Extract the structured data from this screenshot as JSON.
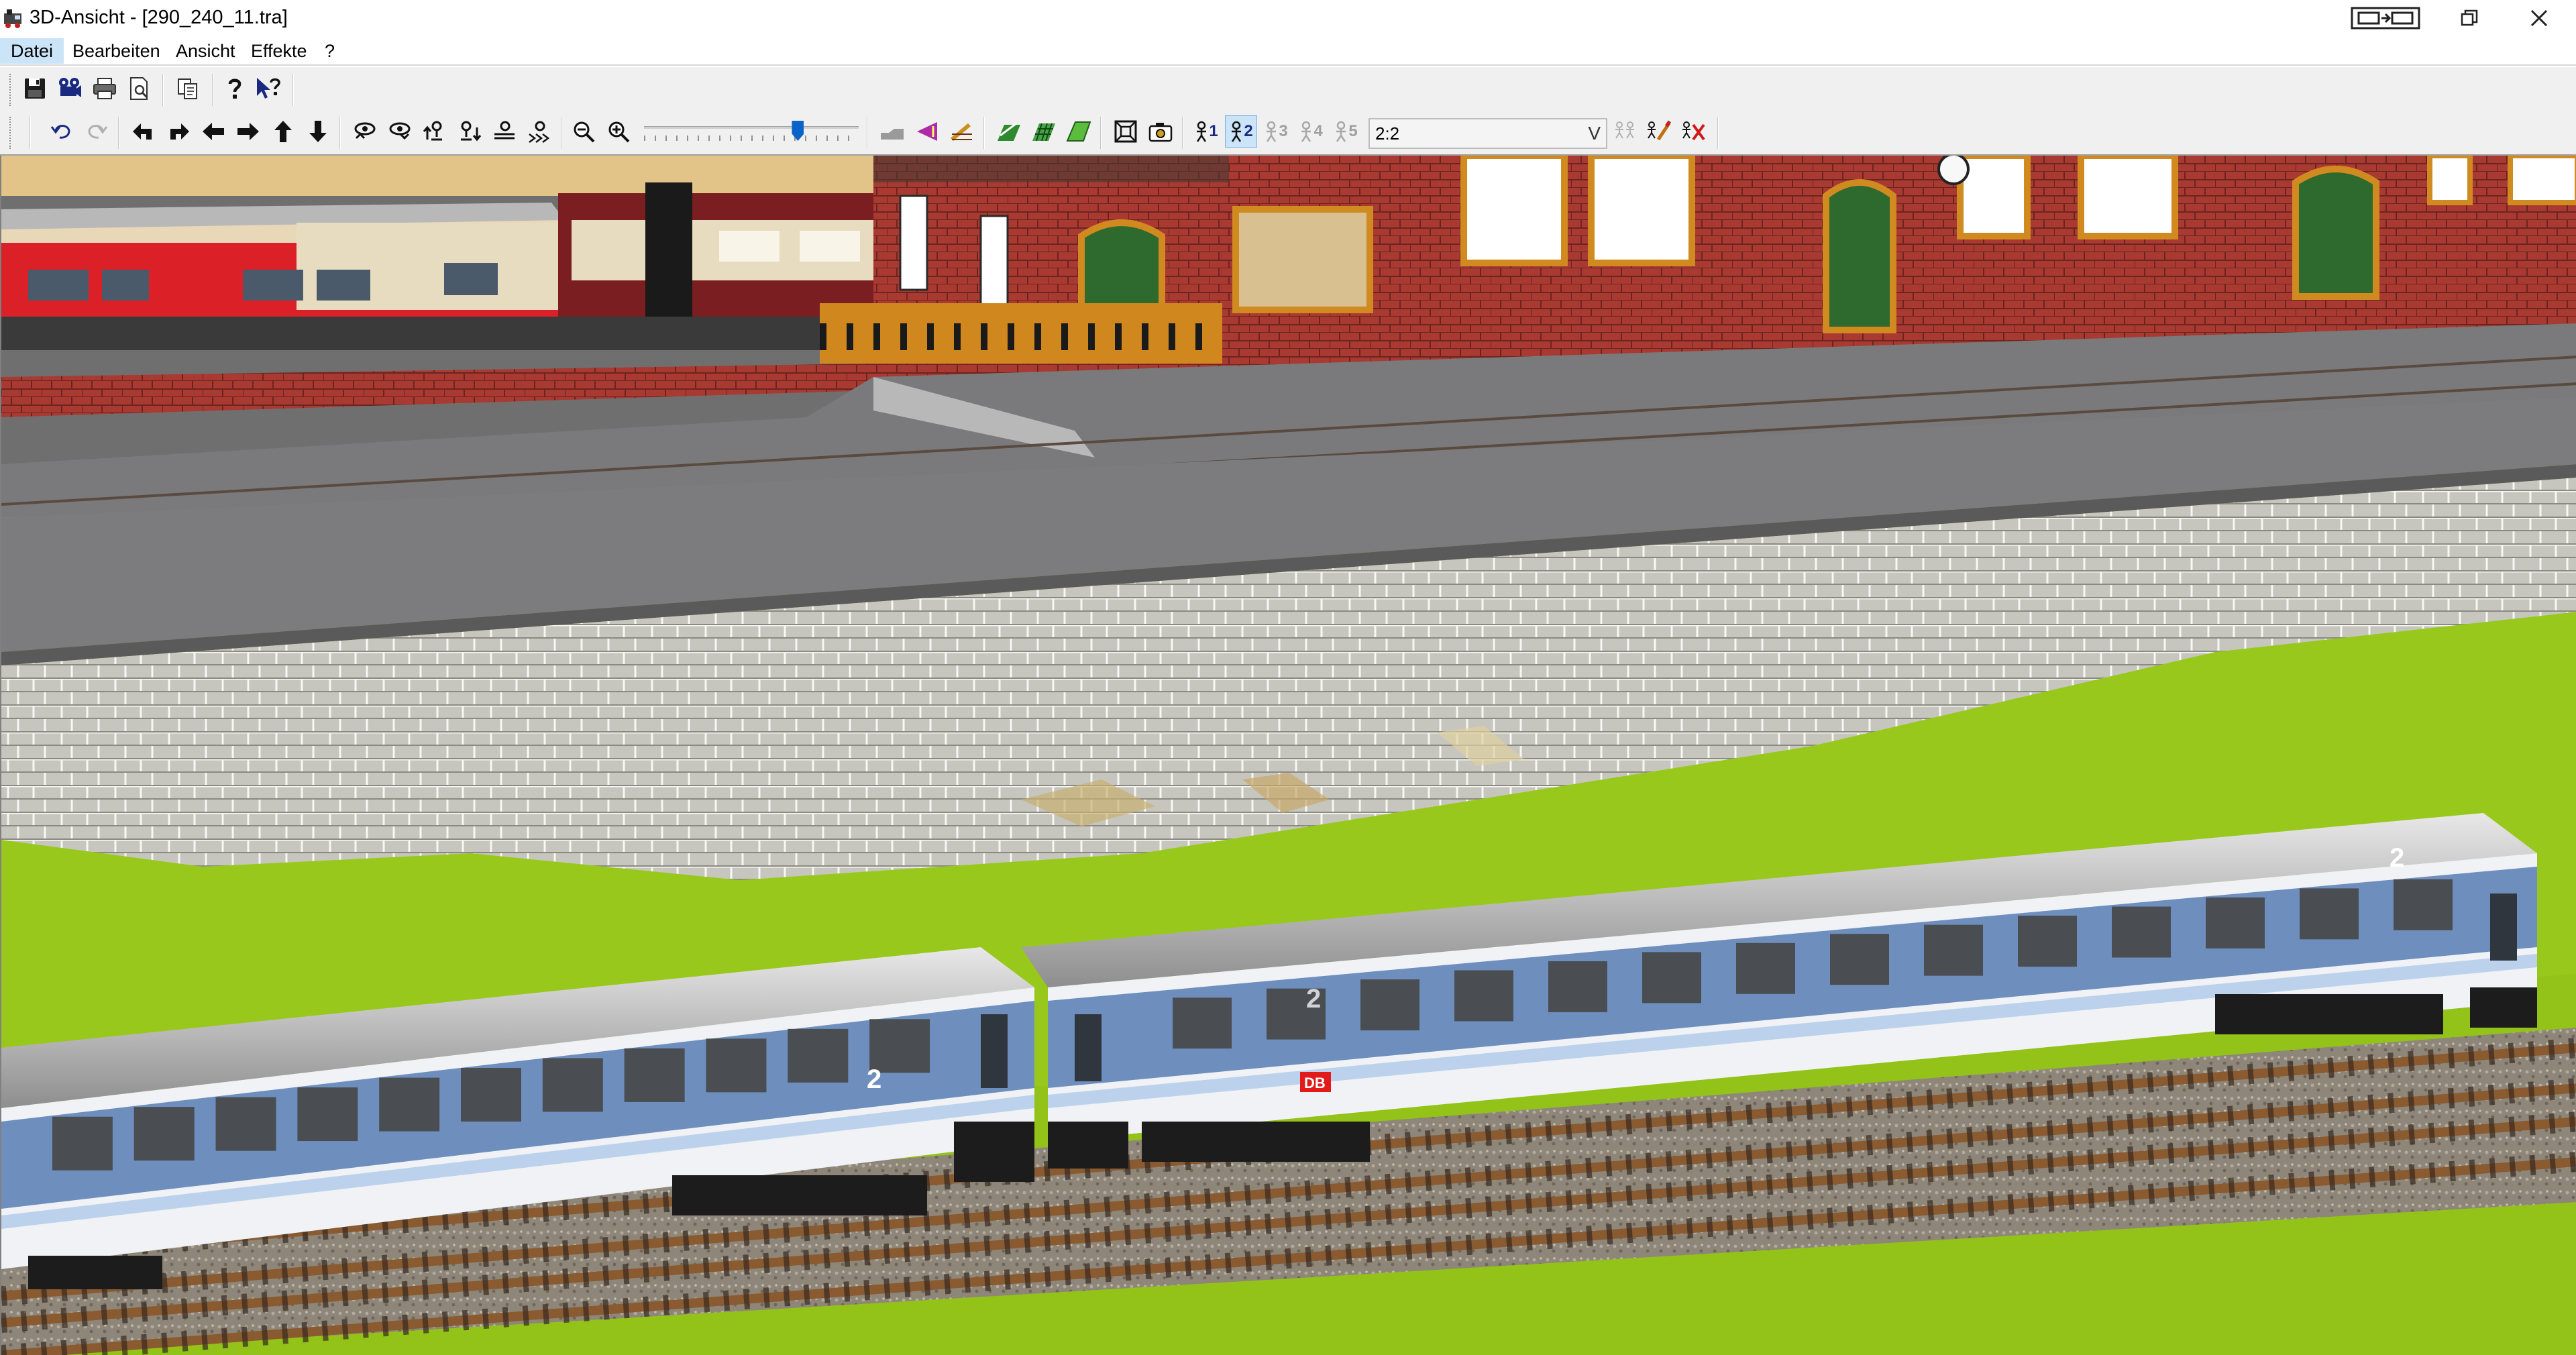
{
  "window": {
    "title": "3D-Ansicht - [290_240_11.tra]"
  },
  "menu": [
    {
      "label": "Datei",
      "active": true
    },
    {
      "label": "Bearbeiten"
    },
    {
      "label": "Ansicht"
    },
    {
      "label": "Effekte"
    },
    {
      "label": "?"
    }
  ],
  "toolbar": {
    "levels": [
      {
        "label": "1",
        "state": "enabled"
      },
      {
        "label": "2",
        "state": "selected"
      },
      {
        "label": "3",
        "state": "disabled"
      },
      {
        "label": "4",
        "state": "disabled"
      },
      {
        "label": "5",
        "state": "disabled"
      }
    ],
    "level_combo_value": "2:2",
    "zoom_level_percent": 73
  },
  "scene": {
    "coach_mark": "2",
    "coach_logo": "DB",
    "colors": {
      "grass": "#98c81c",
      "brick": "#a83a32",
      "coach_blue": "#6e8fbe",
      "stone_wall": "#c4c4bc",
      "platform": "#6f6f70"
    }
  }
}
